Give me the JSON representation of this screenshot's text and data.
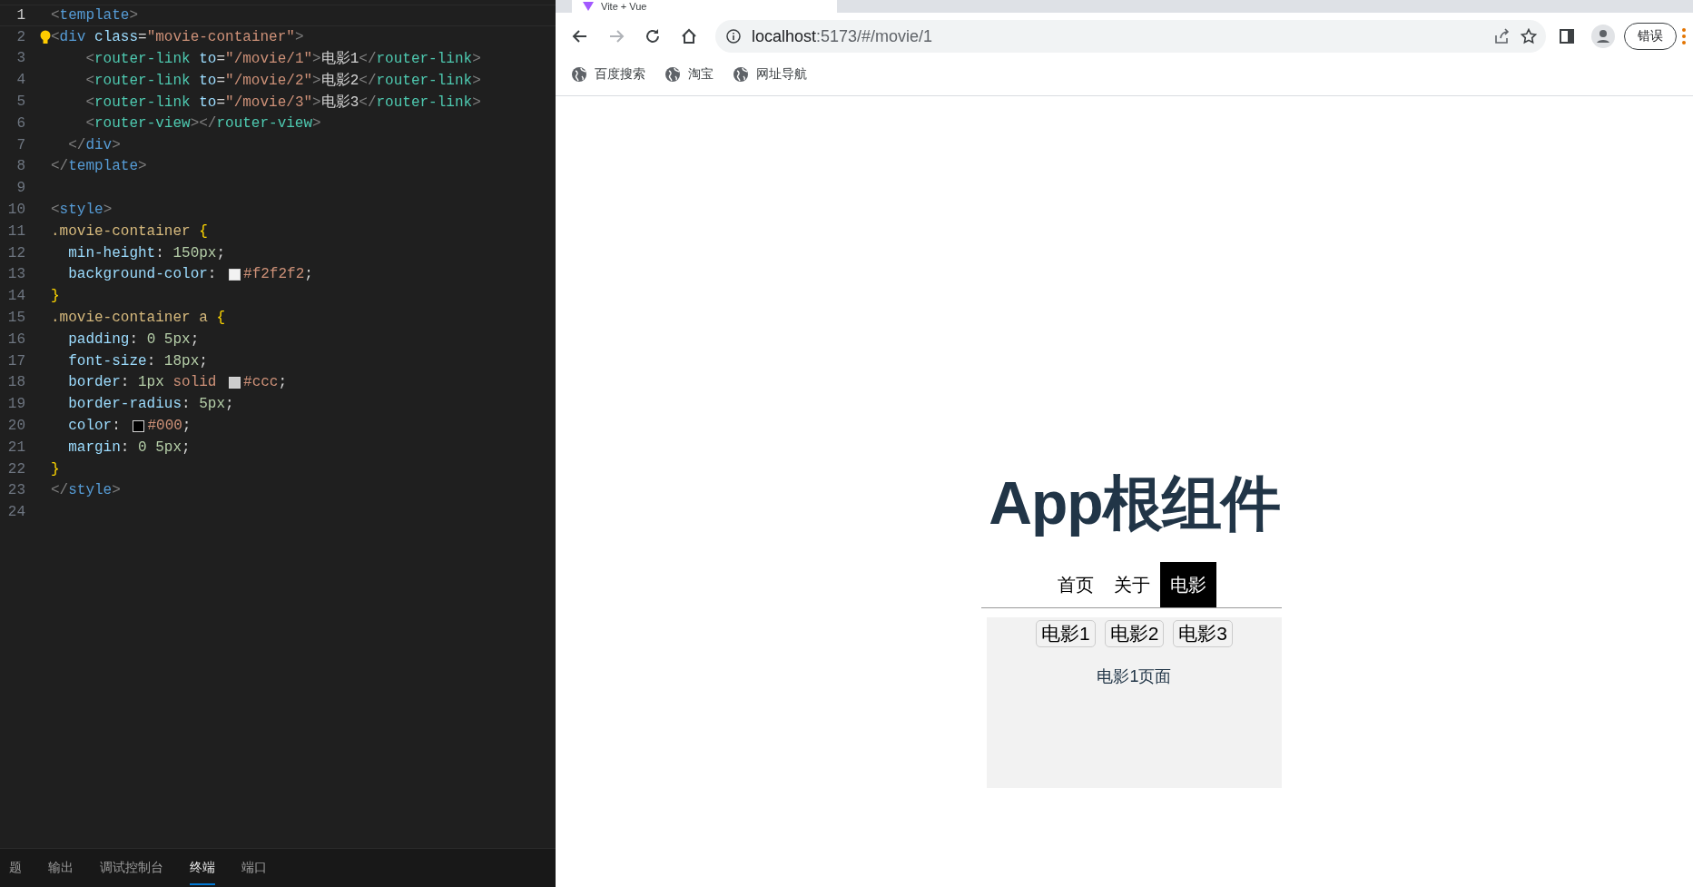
{
  "editor": {
    "lines": [
      {
        "number": "1",
        "current": true,
        "hint": false,
        "code": "<template>"
      },
      {
        "number": "2",
        "current": false,
        "hint": true,
        "code": "<div class=\"movie-container\">"
      },
      {
        "number": "3",
        "current": false,
        "hint": false,
        "code": "    <router-link to=\"/movie/1\">电影1</router-link>"
      },
      {
        "number": "4",
        "current": false,
        "hint": false,
        "code": "    <router-link to=\"/movie/2\">电影2</router-link>"
      },
      {
        "number": "5",
        "current": false,
        "hint": false,
        "code": "    <router-link to=\"/movie/3\">电影3</router-link>"
      },
      {
        "number": "6",
        "current": false,
        "hint": false,
        "code": "    <router-view></router-view>"
      },
      {
        "number": "7",
        "current": false,
        "hint": false,
        "code": "  </div>"
      },
      {
        "number": "8",
        "current": false,
        "hint": false,
        "code": "</template>"
      },
      {
        "number": "9",
        "current": false,
        "hint": false
      },
      {
        "number": "10",
        "current": false,
        "hint": false,
        "code": "<style>"
      },
      {
        "number": "11",
        "current": false,
        "hint": false,
        "code": ".movie-container {"
      },
      {
        "number": "12",
        "current": false,
        "hint": false,
        "code": "  min-height: 150px;"
      },
      {
        "number": "13",
        "current": false,
        "hint": false,
        "code": "  background-color: #f2f2f2;"
      },
      {
        "number": "14",
        "current": false,
        "hint": false,
        "code": "}"
      },
      {
        "number": "15",
        "current": false,
        "hint": false,
        "code": ".movie-container a {"
      },
      {
        "number": "16",
        "current": false,
        "hint": false,
        "code": "  padding: 0 5px;"
      },
      {
        "number": "17",
        "current": false,
        "hint": false,
        "code": "  font-size: 18px;"
      },
      {
        "number": "18",
        "current": false,
        "hint": false,
        "code": "  border: 1px solid #ccc;"
      },
      {
        "number": "19",
        "current": false,
        "hint": false,
        "code": "  border-radius: 5px;"
      },
      {
        "number": "20",
        "current": false,
        "hint": false,
        "code": "  color: #000;"
      },
      {
        "number": "21",
        "current": false,
        "hint": false,
        "code": "  margin: 0 5px;"
      },
      {
        "number": "22",
        "current": false,
        "hint": false,
        "code": "}"
      },
      {
        "number": "23",
        "current": false,
        "hint": false,
        "code": "</style>"
      },
      {
        "number": "24",
        "current": false,
        "hint": false
      }
    ],
    "panel_tabs": [
      {
        "label": "题",
        "selected": false
      },
      {
        "label": "输出",
        "selected": false
      },
      {
        "label": "调试控制台",
        "selected": false
      },
      {
        "label": "终端",
        "selected": true
      },
      {
        "label": "端口",
        "selected": false
      }
    ]
  },
  "browser": {
    "tab_title": "Vite + Vue",
    "address": {
      "host": "localhost",
      "path": ":5173/#/movie/1"
    },
    "forward_disabled": true,
    "error_button": "错误",
    "bookmarks": [
      "百度搜索",
      "淘宝",
      "网址导航"
    ],
    "page": {
      "heading": "App根组件",
      "nav": [
        {
          "label": "首页",
          "selected": false
        },
        {
          "label": "关于",
          "selected": false
        },
        {
          "label": "电影",
          "selected": true
        }
      ],
      "movie_links": [
        "电影1",
        "电影2",
        "电影3"
      ],
      "content": "电影1页面"
    }
  }
}
